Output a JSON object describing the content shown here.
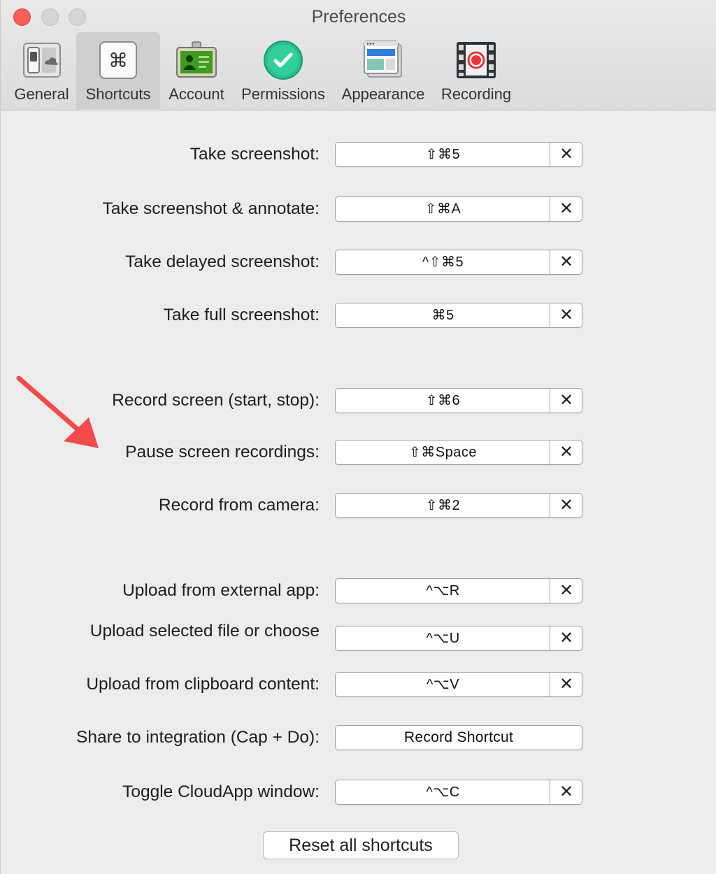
{
  "window": {
    "title": "Preferences"
  },
  "toolbar": {
    "items": [
      {
        "label": "General",
        "icon": "switch-cloud-icon"
      },
      {
        "label": "Shortcuts",
        "icon": "command-key-icon",
        "selected": true
      },
      {
        "label": "Account",
        "icon": "id-card-icon"
      },
      {
        "label": "Permissions",
        "icon": "checkmark-circle-icon"
      },
      {
        "label": "Appearance",
        "icon": "window-layout-icon"
      },
      {
        "label": "Recording",
        "icon": "film-record-icon"
      }
    ]
  },
  "shortcuts": [
    {
      "label": "Take screenshot:",
      "key": "⇧⌘5"
    },
    {
      "label": "Take screenshot & annotate:",
      "key": "⇧⌘A"
    },
    {
      "label": "Take delayed screenshot:",
      "key": "^⇧⌘5"
    },
    {
      "label": "Take full screenshot:",
      "key": "⌘5"
    },
    {
      "label": "Record screen (start, stop):",
      "key": "⇧⌘6"
    },
    {
      "label": "Pause screen recordings:",
      "key": "⇧⌘Space"
    },
    {
      "label": "Record from camera:",
      "key": "⇧⌘2"
    },
    {
      "label": "Upload from external app:",
      "key": "^⌥R"
    },
    {
      "label": "Upload selected file or choose",
      "key": "^⌥U"
    },
    {
      "label": "Upload from clipboard content:",
      "key": "^⌥V"
    },
    {
      "label": "Share to integration (Cap + Do):",
      "key": "Record Shortcut"
    },
    {
      "label": "Toggle CloudApp window:",
      "key": "^⌥C"
    }
  ],
  "clear_glyph": "✕",
  "reset_label": "Reset all shortcuts",
  "annotation": {
    "arrow_color": "#f24b4b"
  }
}
